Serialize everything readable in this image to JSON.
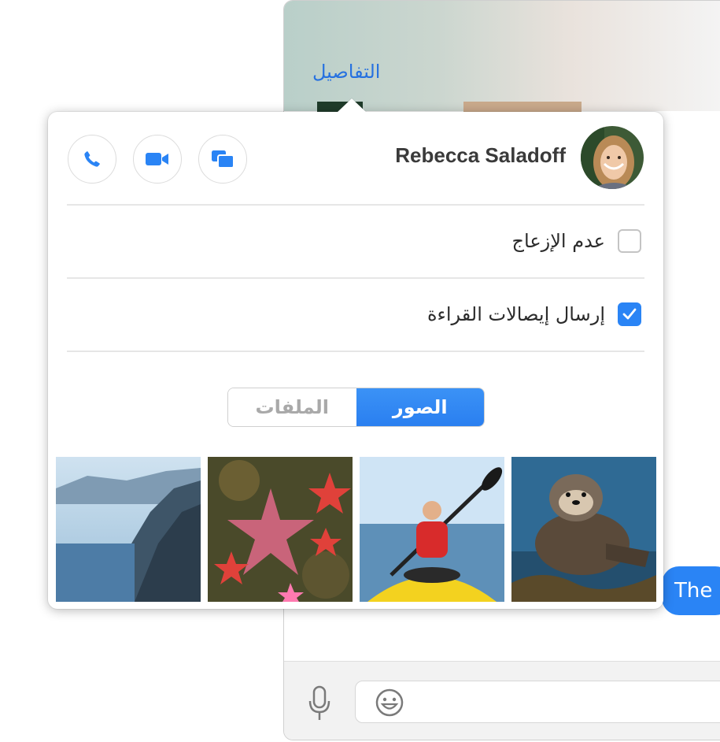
{
  "window": {
    "details_label": "التفاصيل",
    "bubble_text": "The"
  },
  "contact": {
    "name": "Rebecca Saladoff"
  },
  "actions": [
    {
      "icon": "phone-icon"
    },
    {
      "icon": "video-camera-icon"
    },
    {
      "icon": "screen-share-icon"
    }
  ],
  "options": {
    "do_not_disturb": {
      "label": "عدم الإزعاج",
      "checked": false
    },
    "read_receipts": {
      "label": "إرسال إيصالات القراءة",
      "checked": true
    }
  },
  "segments": {
    "photos_label": "الصور",
    "files_label": "الملفات",
    "selected": "photos"
  },
  "colors": {
    "accent": "#2a84f5",
    "link": "#2671e0"
  }
}
